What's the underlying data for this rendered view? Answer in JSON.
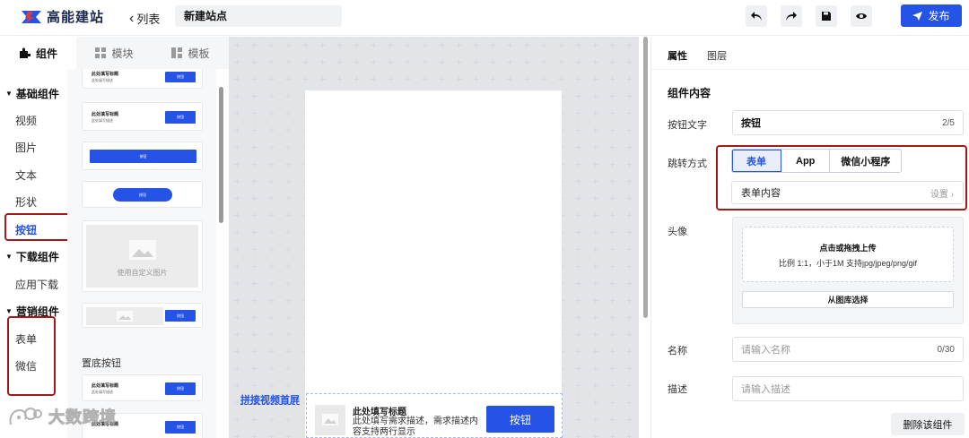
{
  "header": {
    "brand": "高能建站",
    "back_label": "列表",
    "site_name": "新建站点",
    "publish_label": "发布",
    "tools": [
      "undo-icon",
      "redo-icon",
      "save-icon",
      "preview-icon"
    ]
  },
  "left_tabs": [
    {
      "label": "组件",
      "icon": "puzzle-icon",
      "active": true
    },
    {
      "label": "模块",
      "icon": "grid-icon",
      "active": false
    },
    {
      "label": "模板",
      "icon": "template-icon",
      "active": false
    }
  ],
  "categories": {
    "basic_group": "基础组件",
    "basic_items": [
      "视频",
      "图片",
      "文本",
      "形状",
      "按钮"
    ],
    "active_item": "按钮",
    "download_group": "下载组件",
    "download_items": [
      "应用下载"
    ],
    "marketing_group": "营销组件",
    "marketing_items": [
      "表单",
      "微信"
    ]
  },
  "palette": {
    "card_title": "此处填写标题",
    "card_desc": "此处填写描述",
    "button_label": "按钮",
    "custom_image_label": "使用自定义图片",
    "section_bottom": "置底按钮"
  },
  "canvas": {
    "label": "拼接视频首屏",
    "bottom_title": "此处填写标题",
    "bottom_desc": "此处填写需求描述，需求描述内容支持两行显示",
    "bottom_button": "按钮"
  },
  "right_panel": {
    "tabs": [
      "属性",
      "图层"
    ],
    "section_title": "组件内容",
    "button_text_label": "按钮文字",
    "button_text_value": "按钮",
    "button_text_count": "2/5",
    "jump_label": "跳转方式",
    "jump_options": [
      "表单",
      "App",
      "微信小程序"
    ],
    "jump_selected": "表单",
    "form_content_label": "表单内容",
    "form_content_action": "设置",
    "avatar_label": "头像",
    "upload_title": "点击或拖拽上传",
    "upload_hint": "比例 1:1，小于1M 支持jpg/jpeg/png/gif",
    "library_button": "从图库选择",
    "name_label": "名称",
    "name_placeholder": "请输入名称",
    "name_count": "0/30",
    "desc_label": "描述",
    "desc_placeholder": "请输入描述",
    "delete_label": "删除该组件"
  },
  "watermark": "大数跨境",
  "colors": {
    "accent": "#2453e6",
    "highlight": "#a11b1b"
  }
}
